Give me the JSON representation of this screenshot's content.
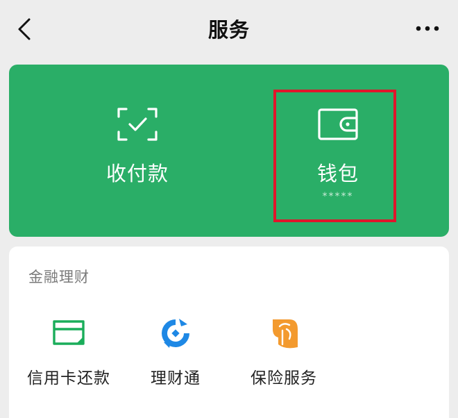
{
  "header": {
    "title": "服务",
    "back_icon": "chevron-left-icon",
    "more_icon": "more-horizontal-icon"
  },
  "green_panel": {
    "pay": {
      "label": "收付款",
      "icon": "scan-check-icon"
    },
    "wallet": {
      "label": "钱包",
      "balance_masked": "*****",
      "icon": "wallet-icon"
    }
  },
  "finance": {
    "title": "金融理财",
    "items": [
      {
        "label": "信用卡还款",
        "icon": "credit-card-icon"
      },
      {
        "label": "理财通",
        "icon": "licaitong-icon"
      },
      {
        "label": "保险服务",
        "icon": "insurance-icon"
      }
    ]
  },
  "colors": {
    "background": "#ededed",
    "green_panel": "#2aae67",
    "highlight_border": "#e0162b",
    "credit_icon": "#1aad5a",
    "licai_icon": "#1e88e5",
    "insurance_icon": "#f39a2e"
  }
}
